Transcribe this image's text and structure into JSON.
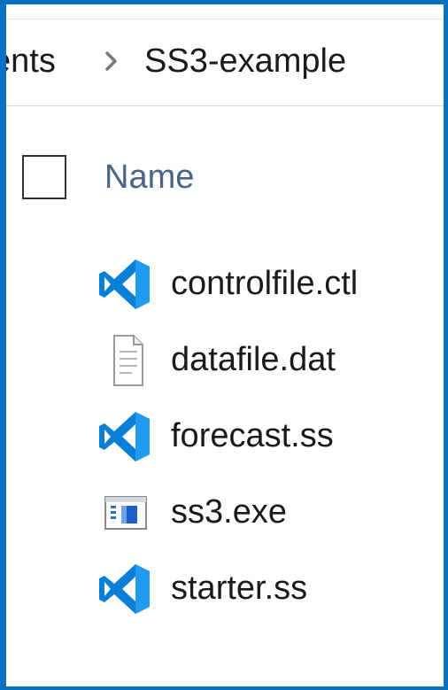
{
  "breadcrumb": {
    "previous": "ents",
    "current": "SS3-example"
  },
  "header": {
    "name_column": "Name"
  },
  "files": [
    {
      "name": "controlfile.ctl",
      "icon": "vscode-icon"
    },
    {
      "name": "datafile.dat",
      "icon": "document-icon"
    },
    {
      "name": "forecast.ss",
      "icon": "vscode-icon"
    },
    {
      "name": "ss3.exe",
      "icon": "exe-icon"
    },
    {
      "name": "starter.ss",
      "icon": "vscode-icon"
    }
  ],
  "colors": {
    "accent": "#0b6fc4",
    "vscode_blue": "#0a7fd6",
    "header_text": "#4a6485"
  }
}
